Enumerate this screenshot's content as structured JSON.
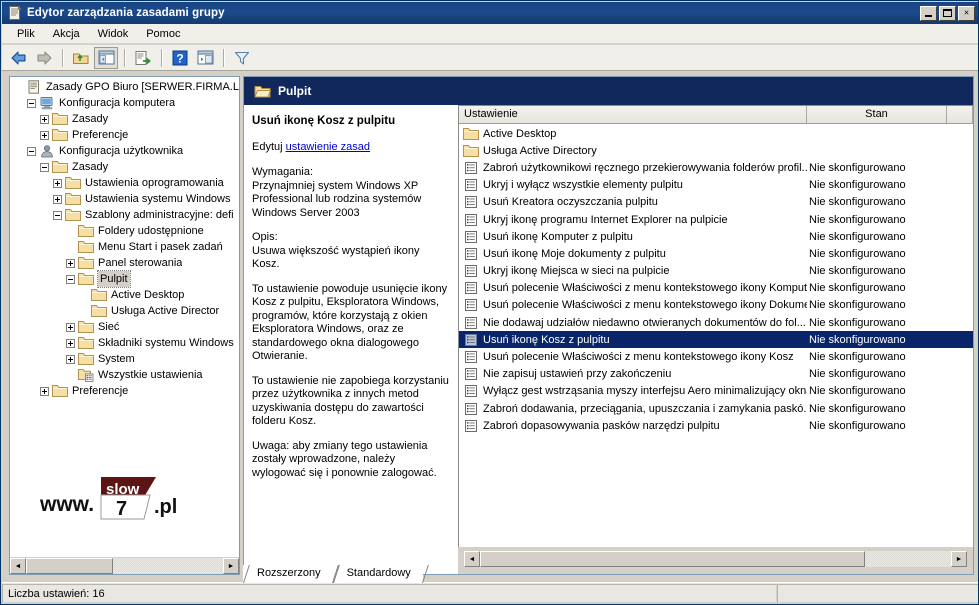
{
  "window": {
    "title": "Edytor zarządzania zasadami grupy",
    "icon": "document-policy-icon",
    "controls": {
      "minimize": "minimize-button",
      "maximize": "maximize-button",
      "close": "×"
    }
  },
  "menubar": {
    "items": [
      {
        "label": "Plik"
      },
      {
        "label": "Akcja"
      },
      {
        "label": "Widok"
      },
      {
        "label": "Pomoc"
      }
    ]
  },
  "toolbar": {
    "buttons": [
      {
        "name": "back-icon",
        "title": "Wstecz"
      },
      {
        "name": "forward-icon",
        "title": "Dalej"
      },
      {
        "name": "up-folder-icon",
        "title": "W górę"
      },
      {
        "name": "show-hide-tree-icon",
        "title": "Pokaż/ukryj drzewo"
      },
      {
        "name": "export-list-icon",
        "title": "Eksportuj listę"
      },
      {
        "name": "help-icon",
        "title": "Pomoc"
      },
      {
        "name": "show-pane-icon",
        "title": "Pokaż okienko"
      },
      {
        "name": "filter-icon",
        "title": "Filtr"
      }
    ]
  },
  "tree": {
    "root": {
      "label": "Zasady GPO Biuro [SERWER.FIRMA.LOCAL",
      "icon": "policy-document-icon",
      "indent": 0,
      "expander": "none"
    },
    "nodes": [
      {
        "label": "Konfiguracja komputera",
        "icon": "computer-icon",
        "indent": 1,
        "expander": "minus"
      },
      {
        "label": "Zasady",
        "icon": "folder-icon",
        "indent": 2,
        "expander": "plus"
      },
      {
        "label": "Preferencje",
        "icon": "folder-icon",
        "indent": 2,
        "expander": "plus"
      },
      {
        "label": "Konfiguracja użytkownika",
        "icon": "user-icon",
        "indent": 1,
        "expander": "minus"
      },
      {
        "label": "Zasady",
        "icon": "folder-icon",
        "indent": 2,
        "expander": "minus"
      },
      {
        "label": "Ustawienia oprogramowania",
        "icon": "folder-icon",
        "indent": 3,
        "expander": "plus"
      },
      {
        "label": "Ustawienia systemu Windows",
        "icon": "folder-icon",
        "indent": 3,
        "expander": "plus"
      },
      {
        "label": "Szablony administracyjne: defi",
        "icon": "folder-icon",
        "indent": 3,
        "expander": "minus"
      },
      {
        "label": "Foldery udostępnione",
        "icon": "folder-icon",
        "indent": 4,
        "expander": "none"
      },
      {
        "label": "Menu Start i pasek zadań",
        "icon": "folder-icon",
        "indent": 4,
        "expander": "none"
      },
      {
        "label": "Panel sterowania",
        "icon": "folder-icon",
        "indent": 4,
        "expander": "plus"
      },
      {
        "label": "Pulpit",
        "icon": "folder-icon",
        "indent": 4,
        "expander": "minus",
        "selected": true
      },
      {
        "label": "Active Desktop",
        "icon": "folder-icon",
        "indent": 5,
        "expander": "none"
      },
      {
        "label": "Usługa Active Director",
        "icon": "folder-icon",
        "indent": 5,
        "expander": "none"
      },
      {
        "label": "Sieć",
        "icon": "folder-icon",
        "indent": 4,
        "expander": "plus"
      },
      {
        "label": "Składniki systemu Windows",
        "icon": "folder-icon",
        "indent": 4,
        "expander": "plus"
      },
      {
        "label": "System",
        "icon": "folder-icon",
        "indent": 4,
        "expander": "plus"
      },
      {
        "label": "Wszystkie ustawienia",
        "icon": "all-settings-icon",
        "indent": 4,
        "expander": "none"
      },
      {
        "label": "Preferencje",
        "icon": "folder-icon",
        "indent": 2,
        "expander": "plus"
      }
    ]
  },
  "watermark": {
    "prefix": "www.",
    "brand": "slow",
    "number": "7",
    "suffix": ".pl"
  },
  "banner": {
    "title": "Pulpit",
    "icon": "folder-open-icon"
  },
  "description": {
    "title": "Usuń ikonę Kosz z pulpitu",
    "edit_prefix": "Edytuj",
    "edit_link": "ustawienie zasad",
    "requirements_head": "Wymagania:",
    "requirements_body": "Przynajmniej system Windows XP Professional lub rodzina systemów Windows Server 2003",
    "opis_head": "Opis:",
    "opis_lead": "Usuwa większość wystąpień ikony Kosz.",
    "paragraph_1": "To ustawienie powoduje usunięcie ikony Kosz z pulpitu, Eksploratora Windows, programów, które korzystają z okien Eksploratora Windows, oraz ze standardowego okna dialogowego Otwieranie.",
    "paragraph_2": "To ustawienie nie zapobiega korzystaniu przez użytkownika z innych metod uzyskiwania dostępu do zawartości folderu Kosz.",
    "paragraph_3": "Uwaga: aby zmiany tego ustawienia zostały wprowadzone, należy wylogować się i ponownie zalogować."
  },
  "list": {
    "columns": [
      {
        "label": "Ustawienie",
        "align": "left"
      },
      {
        "label": "Stan",
        "align": "center"
      },
      {
        "label": "",
        "align": "left"
      }
    ],
    "rows": [
      {
        "name": "Active Desktop",
        "state": "",
        "icon": "folder-icon",
        "selected": false
      },
      {
        "name": "Usługa Active Directory",
        "state": "",
        "icon": "folder-icon",
        "selected": false
      },
      {
        "name": "Zabroń użytkownikowi ręcznego przekierowywania folderów profil...",
        "state": "Nie skonfigurowano",
        "icon": "policy-setting-icon",
        "selected": false
      },
      {
        "name": "Ukryj i wyłącz wszystkie elementy pulpitu",
        "state": "Nie skonfigurowano",
        "icon": "policy-setting-icon",
        "selected": false
      },
      {
        "name": "Usuń Kreatora oczyszczania pulpitu",
        "state": "Nie skonfigurowano",
        "icon": "policy-setting-icon",
        "selected": false
      },
      {
        "name": "Ukryj ikonę programu Internet Explorer na pulpicie",
        "state": "Nie skonfigurowano",
        "icon": "policy-setting-icon",
        "selected": false
      },
      {
        "name": "Usuń ikonę Komputer z pulpitu",
        "state": "Nie skonfigurowano",
        "icon": "policy-setting-icon",
        "selected": false
      },
      {
        "name": "Usuń ikonę Moje dokumenty z pulpitu",
        "state": "Nie skonfigurowano",
        "icon": "policy-setting-icon",
        "selected": false
      },
      {
        "name": "Ukryj ikonę Miejsca w sieci na pulpicie",
        "state": "Nie skonfigurowano",
        "icon": "policy-setting-icon",
        "selected": false
      },
      {
        "name": "Usuń polecenie Właściwości z menu kontekstowego ikony Komputer",
        "state": "Nie skonfigurowano",
        "icon": "policy-setting-icon",
        "selected": false
      },
      {
        "name": "Usuń polecenie Właściwości z menu kontekstowego ikony Dokume...",
        "state": "Nie skonfigurowano",
        "icon": "policy-setting-icon",
        "selected": false
      },
      {
        "name": "Nie dodawaj udziałów niedawno otwieranych dokumentów do fol...",
        "state": "Nie skonfigurowano",
        "icon": "policy-setting-icon",
        "selected": false
      },
      {
        "name": "Usuń ikonę Kosz z pulpitu",
        "state": "Nie skonfigurowano",
        "icon": "policy-setting-icon",
        "selected": true
      },
      {
        "name": "Usuń polecenie Właściwości z menu kontekstowego ikony Kosz",
        "state": "Nie skonfigurowano",
        "icon": "policy-setting-icon",
        "selected": false
      },
      {
        "name": "Nie zapisuj ustawień przy zakończeniu",
        "state": "Nie skonfigurowano",
        "icon": "policy-setting-icon",
        "selected": false
      },
      {
        "name": "Wyłącz gest wstrząsania myszy interfejsu Aero minimalizujący okna",
        "state": "Nie skonfigurowano",
        "icon": "policy-setting-icon",
        "selected": false
      },
      {
        "name": "Zabroń dodawania, przeciągania, upuszczania i zamykania paskó...",
        "state": "Nie skonfigurowano",
        "icon": "policy-setting-icon",
        "selected": false
      },
      {
        "name": "Zabroń dopasowywania pasków narzędzi pulpitu",
        "state": "Nie skonfigurowano",
        "icon": "policy-setting-icon",
        "selected": false
      }
    ]
  },
  "tabs": [
    {
      "label": "Rozszerzony",
      "active": true
    },
    {
      "label": "Standardowy",
      "active": false
    }
  ],
  "statusbar": {
    "text": "Liczba ustawień:  16"
  },
  "colors": {
    "title_bar": "#1a4480",
    "banner": "#11285c",
    "selection": "#0a246a",
    "window_face": "#d4d0c8",
    "link": "#0000cc"
  }
}
